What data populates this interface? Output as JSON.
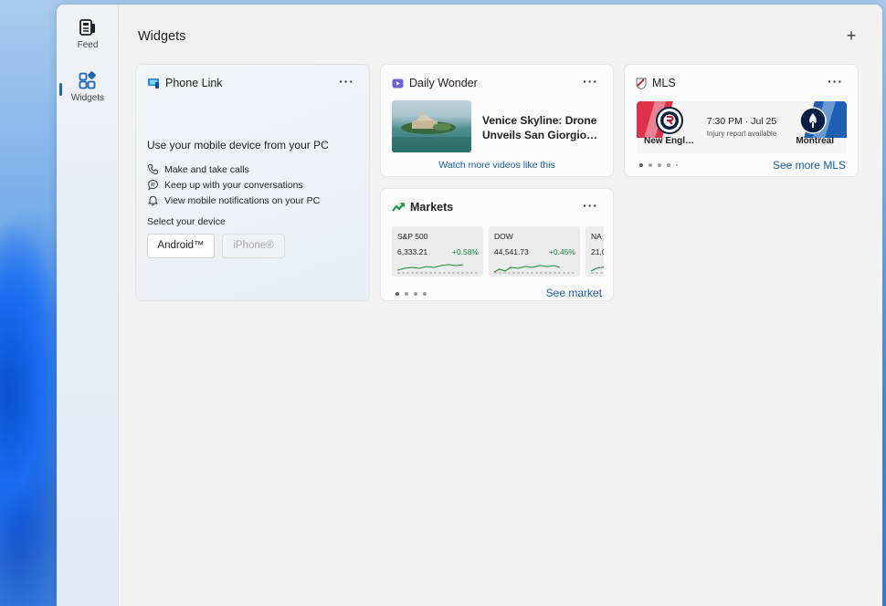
{
  "rail": {
    "feed_label": "Feed",
    "widgets_label": "Widgets"
  },
  "header": {
    "title": "Widgets",
    "add_label": "+"
  },
  "phone_link": {
    "title": "Phone Link",
    "more": "···",
    "headline": "Use your mobile device from your PC",
    "features": [
      "Make and take calls",
      "Keep up with your conversations",
      "View mobile notifications on your PC"
    ],
    "select_label": "Select your device",
    "android_label": "Android™",
    "iphone_label": "iPhone®"
  },
  "daily_wonder": {
    "title": "Daily Wonder",
    "more": "···",
    "headline_line1": "Venice Skyline: Drone",
    "headline_line2": "Unveils San Giorgio…",
    "link": "Watch more videos like this"
  },
  "mls": {
    "title": "MLS",
    "more": "···",
    "home_team": "New Engl…",
    "away_team": "Montreal",
    "time": "7:30 PM · Jul 25",
    "note": "Injury report available",
    "link": "See more MLS"
  },
  "markets": {
    "title": "Markets",
    "more": "···",
    "tiles": [
      {
        "name": "S&P 500",
        "value": "6,333.21",
        "change": "+0.58%"
      },
      {
        "name": "DOW",
        "value": "44,541.73",
        "change": "+0.45%"
      },
      {
        "name": "NA",
        "value": "21,0"
      }
    ],
    "link": "See market"
  },
  "colors": {
    "accent": "#1c66b6",
    "positive": "#138a36",
    "link": "#1a5fa8"
  }
}
